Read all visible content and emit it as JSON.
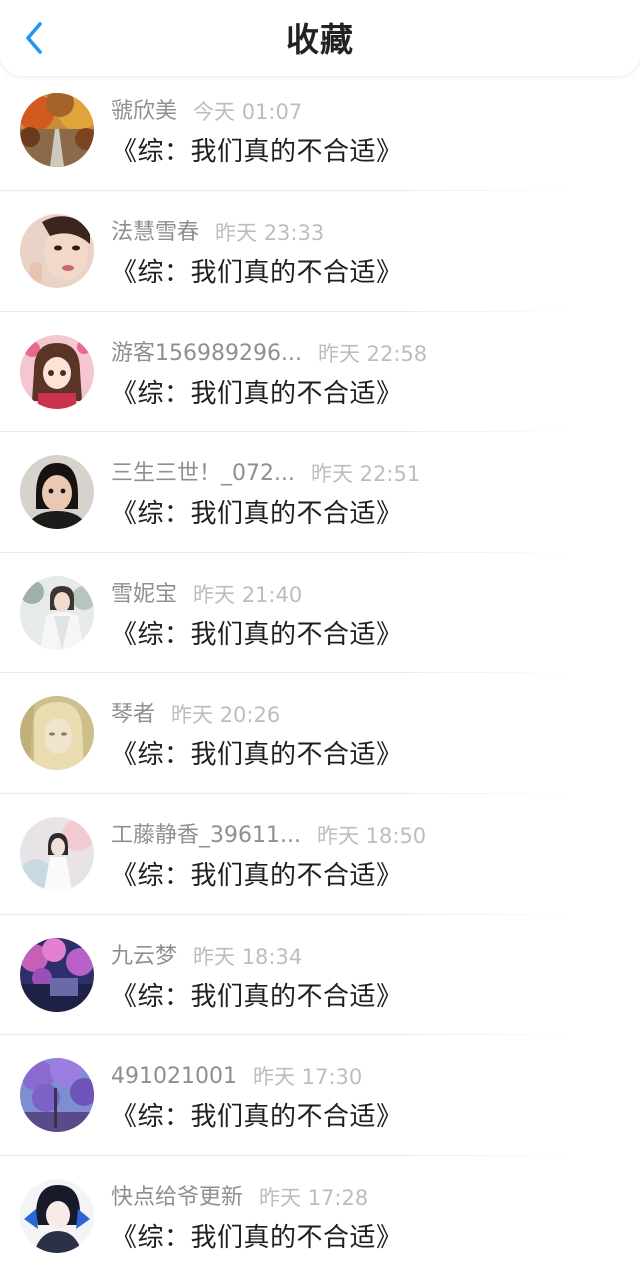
{
  "header": {
    "title": "收藏",
    "back_icon": "chevron-left-icon",
    "accent": "#2196f3"
  },
  "items": [
    {
      "name": "虢欣美",
      "time": "今天 01:07",
      "book": "《综：我们真的不合适》"
    },
    {
      "name": "法慧雪春",
      "time": "昨天 23:33",
      "book": "《综：我们真的不合适》"
    },
    {
      "name": "游客156989296...",
      "time": "昨天 22:58",
      "book": "《综：我们真的不合适》"
    },
    {
      "name": "三生三世！_072...",
      "time": "昨天 22:51",
      "book": "《综：我们真的不合适》"
    },
    {
      "name": "雪妮宝",
      "time": "昨天 21:40",
      "book": "《综：我们真的不合适》"
    },
    {
      "name": "琴者",
      "time": "昨天 20:26",
      "book": "《综：我们真的不合适》"
    },
    {
      "name": "工藤静香_39611...",
      "time": "昨天 18:50",
      "book": "《综：我们真的不合适》"
    },
    {
      "name": "九云梦",
      "time": "昨天 18:34",
      "book": "《综：我们真的不合适》"
    },
    {
      "name": "491021001",
      "time": "昨天 17:30",
      "book": "《综：我们真的不合适》"
    },
    {
      "name": "快点给爷更新",
      "time": "昨天 17:28",
      "book": "《综：我们真的不合适》"
    }
  ]
}
